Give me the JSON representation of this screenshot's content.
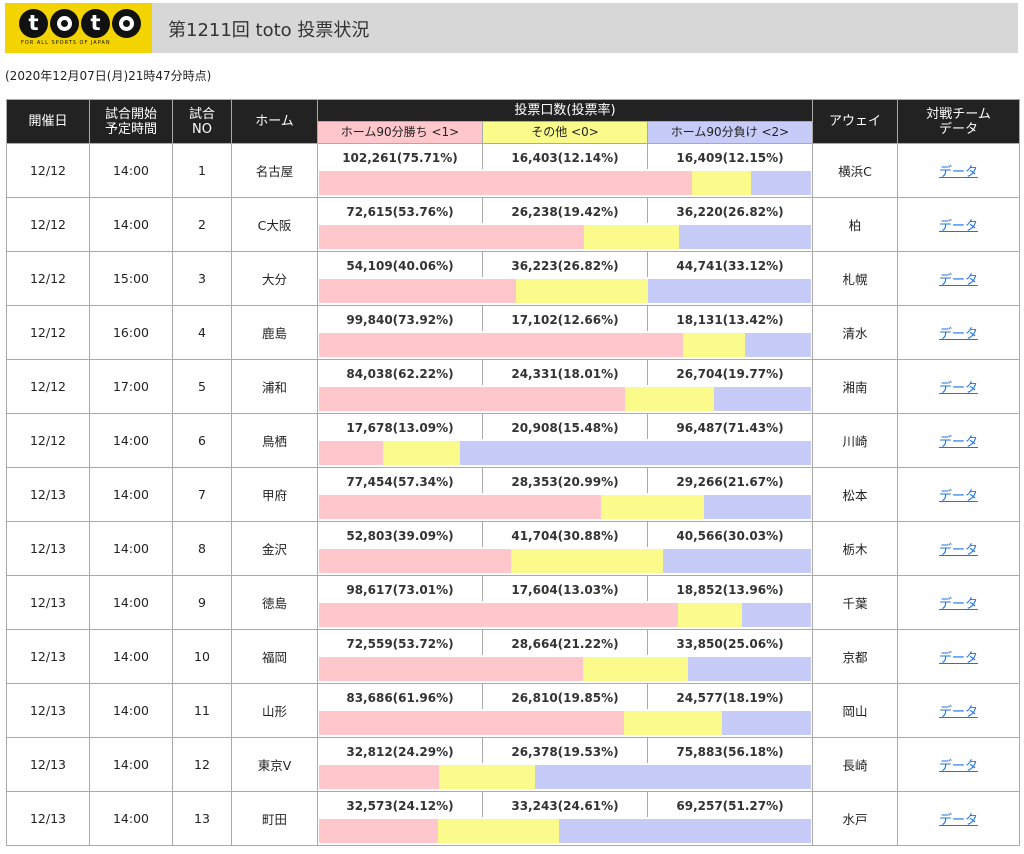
{
  "header": {
    "logo_text": "toto",
    "logo_tagline": "FOR ALL SPORTS OF JAPAN",
    "title": "第1211回 toto 投票状況"
  },
  "timestamp": "(2020年12月07日(月)21時47分時点)",
  "table": {
    "headers": {
      "date": "開催日",
      "time_line1": "試合開始",
      "time_line2": "予定時間",
      "no_line1": "試合",
      "no_line2": "NO",
      "home": "ホーム",
      "votes": "投票口数(投票率)",
      "win": "ホーム90分勝ち <1>",
      "draw": "その他 <0>",
      "lose": "ホーム90分負け <2>",
      "away": "アウェイ",
      "data_line1": "対戦チーム",
      "data_line2": "データ"
    },
    "colors": {
      "win": "#ffc6cc",
      "draw": "#fbfb8c",
      "lose": "#c6ccf7",
      "header_bg": "#222222",
      "link": "#1a73e8"
    },
    "rows": [
      {
        "date": "12/12",
        "time": "14:00",
        "no": "1",
        "home": "名古屋",
        "win": "102,261(75.71%)",
        "draw": "16,403(12.14%)",
        "lose": "16,409(12.15%)",
        "away": "横浜C",
        "link": "データ",
        "win_pct": 75.71,
        "draw_pct": 12.14,
        "lose_pct": 12.15
      },
      {
        "date": "12/12",
        "time": "14:00",
        "no": "2",
        "home": "C大阪",
        "win": "72,615(53.76%)",
        "draw": "26,238(19.42%)",
        "lose": "36,220(26.82%)",
        "away": "柏",
        "link": "データ",
        "win_pct": 53.76,
        "draw_pct": 19.42,
        "lose_pct": 26.82
      },
      {
        "date": "12/12",
        "time": "15:00",
        "no": "3",
        "home": "大分",
        "win": "54,109(40.06%)",
        "draw": "36,223(26.82%)",
        "lose": "44,741(33.12%)",
        "away": "札幌",
        "link": "データ",
        "win_pct": 40.06,
        "draw_pct": 26.82,
        "lose_pct": 33.12
      },
      {
        "date": "12/12",
        "time": "16:00",
        "no": "4",
        "home": "鹿島",
        "win": "99,840(73.92%)",
        "draw": "17,102(12.66%)",
        "lose": "18,131(13.42%)",
        "away": "清水",
        "link": "データ",
        "win_pct": 73.92,
        "draw_pct": 12.66,
        "lose_pct": 13.42
      },
      {
        "date": "12/12",
        "time": "17:00",
        "no": "5",
        "home": "浦和",
        "win": "84,038(62.22%)",
        "draw": "24,331(18.01%)",
        "lose": "26,704(19.77%)",
        "away": "湘南",
        "link": "データ",
        "win_pct": 62.22,
        "draw_pct": 18.01,
        "lose_pct": 19.77
      },
      {
        "date": "12/12",
        "time": "14:00",
        "no": "6",
        "home": "鳥栖",
        "win": "17,678(13.09%)",
        "draw": "20,908(15.48%)",
        "lose": "96,487(71.43%)",
        "away": "川崎",
        "link": "データ",
        "win_pct": 13.09,
        "draw_pct": 15.48,
        "lose_pct": 71.43
      },
      {
        "date": "12/13",
        "time": "14:00",
        "no": "7",
        "home": "甲府",
        "win": "77,454(57.34%)",
        "draw": "28,353(20.99%)",
        "lose": "29,266(21.67%)",
        "away": "松本",
        "link": "データ",
        "win_pct": 57.34,
        "draw_pct": 20.99,
        "lose_pct": 21.67
      },
      {
        "date": "12/13",
        "time": "14:00",
        "no": "8",
        "home": "金沢",
        "win": "52,803(39.09%)",
        "draw": "41,704(30.88%)",
        "lose": "40,566(30.03%)",
        "away": "栃木",
        "link": "データ",
        "win_pct": 39.09,
        "draw_pct": 30.88,
        "lose_pct": 30.03
      },
      {
        "date": "12/13",
        "time": "14:00",
        "no": "9",
        "home": "徳島",
        "win": "98,617(73.01%)",
        "draw": "17,604(13.03%)",
        "lose": "18,852(13.96%)",
        "away": "千葉",
        "link": "データ",
        "win_pct": 73.01,
        "draw_pct": 13.03,
        "lose_pct": 13.96
      },
      {
        "date": "12/13",
        "time": "14:00",
        "no": "10",
        "home": "福岡",
        "win": "72,559(53.72%)",
        "draw": "28,664(21.22%)",
        "lose": "33,850(25.06%)",
        "away": "京都",
        "link": "データ",
        "win_pct": 53.72,
        "draw_pct": 21.22,
        "lose_pct": 25.06
      },
      {
        "date": "12/13",
        "time": "14:00",
        "no": "11",
        "home": "山形",
        "win": "83,686(61.96%)",
        "draw": "26,810(19.85%)",
        "lose": "24,577(18.19%)",
        "away": "岡山",
        "link": "データ",
        "win_pct": 61.96,
        "draw_pct": 19.85,
        "lose_pct": 18.19
      },
      {
        "date": "12/13",
        "time": "14:00",
        "no": "12",
        "home": "東京V",
        "win": "32,812(24.29%)",
        "draw": "26,378(19.53%)",
        "lose": "75,883(56.18%)",
        "away": "長崎",
        "link": "データ",
        "win_pct": 24.29,
        "draw_pct": 19.53,
        "lose_pct": 56.18
      },
      {
        "date": "12/13",
        "time": "14:00",
        "no": "13",
        "home": "町田",
        "win": "32,573(24.12%)",
        "draw": "33,243(24.61%)",
        "lose": "69,257(51.27%)",
        "away": "水戸",
        "link": "データ",
        "win_pct": 24.12,
        "draw_pct": 24.61,
        "lose_pct": 51.27
      }
    ]
  }
}
